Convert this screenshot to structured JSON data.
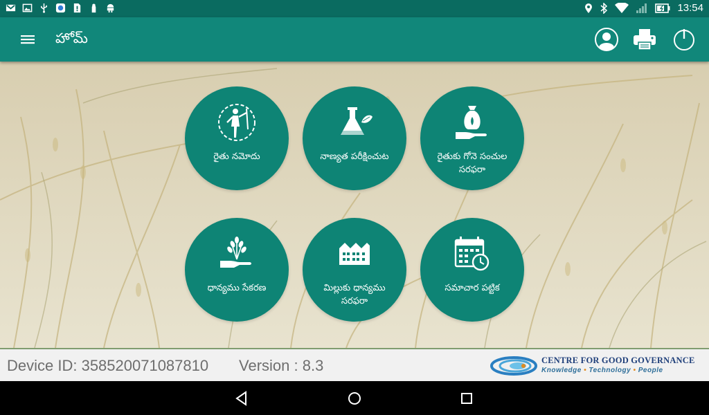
{
  "status_bar": {
    "left_icons": [
      "gmail-icon",
      "image-icon",
      "usb-icon",
      "app-icon",
      "sim-icon",
      "lock-icon",
      "android-icon"
    ],
    "right_icons": [
      "location-icon",
      "bluetooth-icon",
      "wifi-icon",
      "signal-icon",
      "battery-icon"
    ],
    "time": "13:54"
  },
  "app_bar": {
    "title": "హోమ్",
    "actions": [
      "profile-icon",
      "printer-icon",
      "power-icon"
    ]
  },
  "tiles": [
    {
      "label": "రైతు నమోదు",
      "icon": "farmer-icon"
    },
    {
      "label": "నాణ్యత పరీక్షించుట",
      "icon": "lab-flask-icon"
    },
    {
      "label": "రైతుకు గోనె సంచుల\nసరఫరా",
      "icon": "sack-hand-icon"
    },
    {
      "label": "ధాన్యము సేకరణ",
      "icon": "wheat-hand-icon"
    },
    {
      "label": "మిల్లుకు ధాన్యము\nసరఫరా",
      "icon": "mill-icon"
    },
    {
      "label": "సమాచార పట్టిక",
      "icon": "calendar-clock-icon"
    }
  ],
  "footer": {
    "device_id": "Device ID: 358520071087810",
    "version": "Version : 8.3",
    "org_name": "CENTRE FOR GOOD GOVERNANCE",
    "org_tagline": [
      "Knowledge",
      "Technology",
      "People"
    ]
  },
  "nav_bar": [
    "back-icon",
    "home-icon",
    "recents-icon"
  ],
  "colors": {
    "primary": "#11877a",
    "status_bar": "#0a6b60",
    "tile": "#0e8475"
  }
}
